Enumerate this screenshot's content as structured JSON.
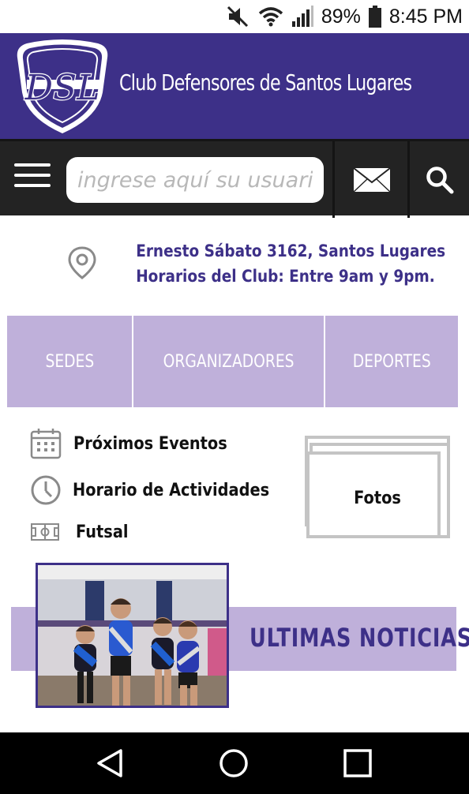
{
  "status_bar": {
    "battery": "89%",
    "time": "8:45 PM",
    "icons": [
      "mute-icon",
      "wifi-icon",
      "signal-icon",
      "battery-icon"
    ]
  },
  "header": {
    "logo_text": "DSL",
    "title": "Club Defensores de Santos Lugares",
    "brand_color": "#3d3088"
  },
  "toolbar": {
    "search_placeholder": "ingrese aquí su usuario...",
    "icons": [
      "menu-icon",
      "mail-icon",
      "search-icon"
    ]
  },
  "address": {
    "line1": "Ernesto Sábato 3162, Santos Lugares",
    "line2": "Horarios del Club: Entre 9am y 9pm.",
    "icon": "location-pin-icon"
  },
  "tabs": [
    {
      "label": "SEDES"
    },
    {
      "label": "ORGANIZADORES"
    },
    {
      "label": "DEPORTES"
    }
  ],
  "quick_links": [
    {
      "label": "Próximos Eventos",
      "icon": "calendar-icon"
    },
    {
      "label": "Horario de Actividades",
      "icon": "clock-icon"
    },
    {
      "label": "Futsal",
      "icon": "futsal-field-icon"
    }
  ],
  "fotos": {
    "label": "Fotos"
  },
  "news": {
    "title": "ULTIMAS  NOTICIAS",
    "accent_color": "#bfb0da"
  },
  "nav_bar": {
    "icons": [
      "back-icon",
      "home-icon",
      "recents-icon"
    ]
  }
}
